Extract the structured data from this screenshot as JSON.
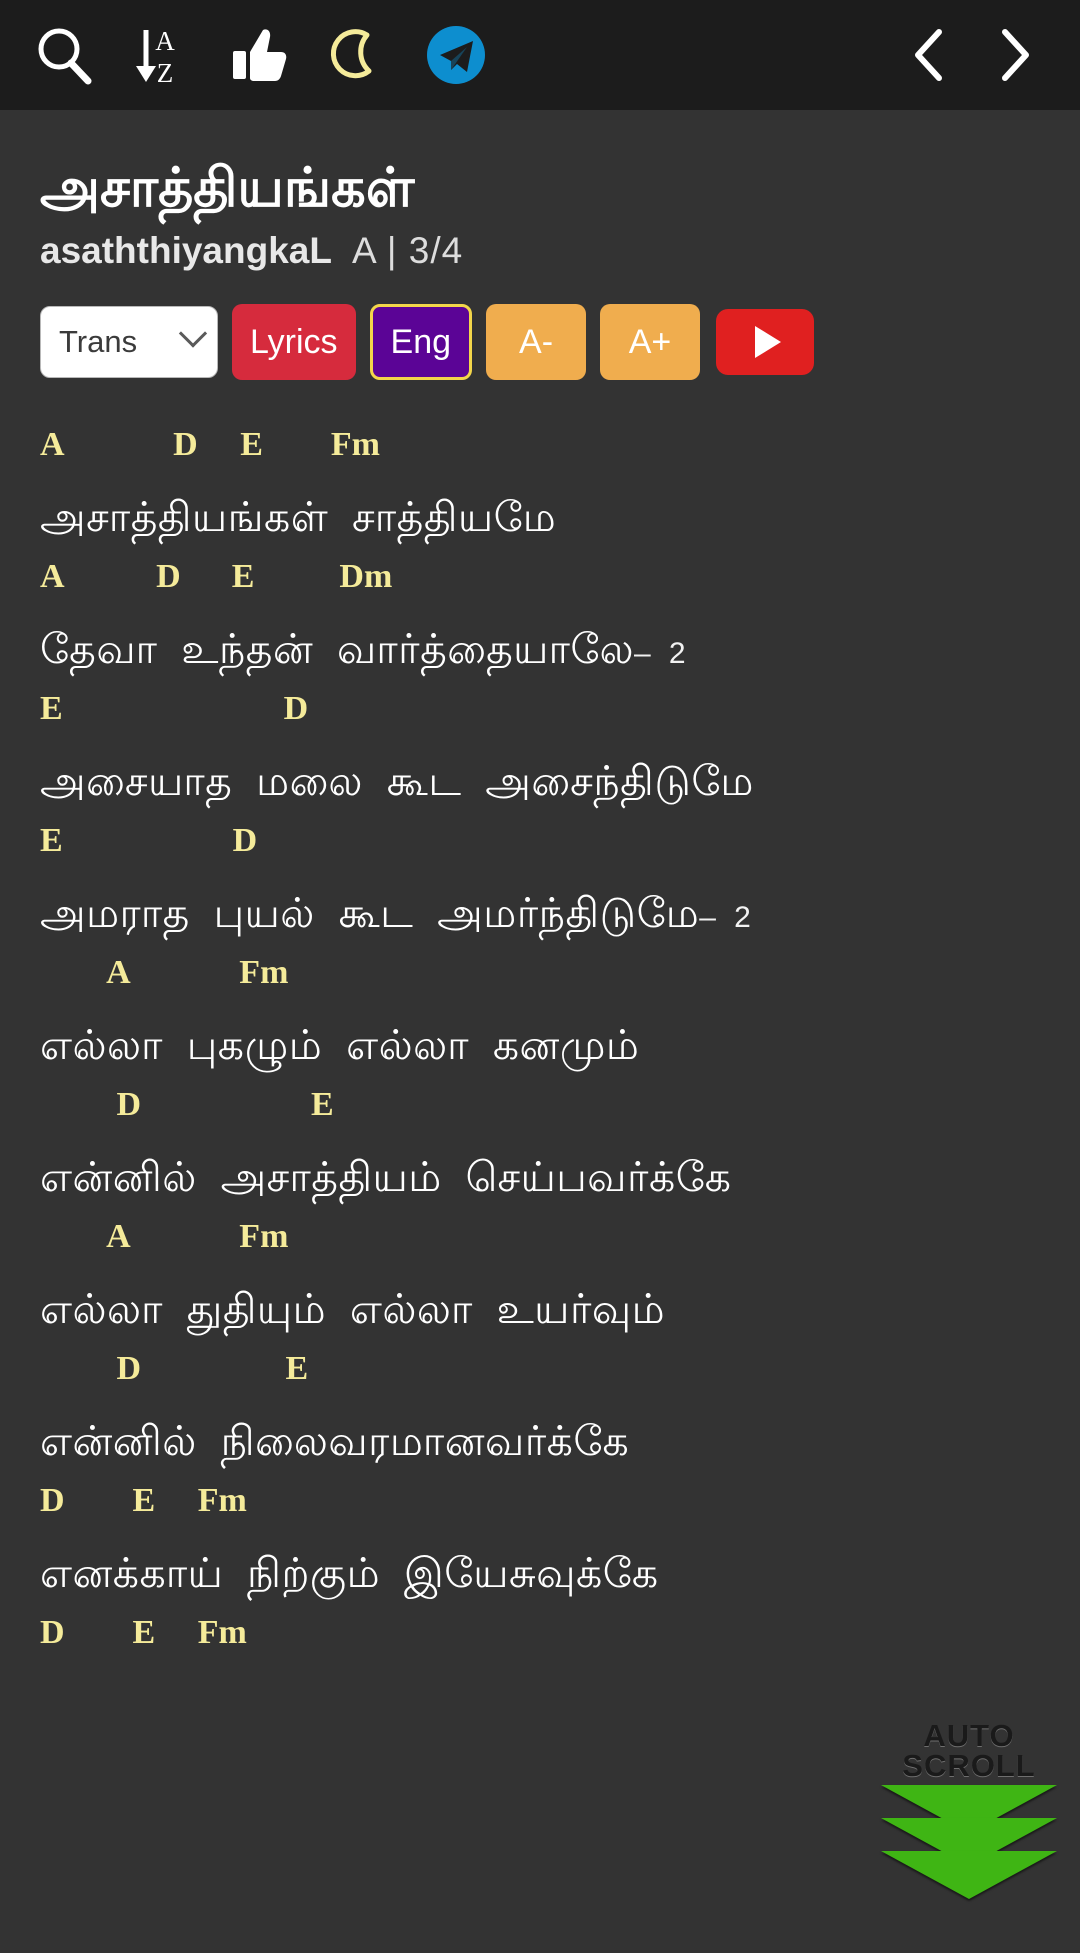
{
  "toolbar": {
    "left_icons": [
      {
        "name": "search-icon",
        "label": "Search"
      },
      {
        "name": "sort-alpha-icon",
        "label": "Sort A-Z"
      },
      {
        "name": "thumbs-up-icon",
        "label": "Like"
      },
      {
        "name": "moon-icon",
        "label": "Night mode"
      },
      {
        "name": "telegram-icon",
        "label": "Telegram"
      }
    ],
    "right_icons": [
      {
        "name": "chevron-left-icon",
        "label": "Previous"
      },
      {
        "name": "chevron-right-icon",
        "label": "Next"
      }
    ]
  },
  "song": {
    "title": "அசாத்தியங்கள்",
    "transliteration": "asaththiyangkaL",
    "key_and_time": "A | 3/4"
  },
  "controls": {
    "trans_label": "Trans",
    "lyrics_label": "Lyrics",
    "eng_label": "Eng",
    "font_decrease_label": "A-",
    "font_increase_label": "A+",
    "youtube_label": "Play on YouTube"
  },
  "colors": {
    "background": "#333333",
    "toolbar_bg": "#1c1c1c",
    "chord": "#f5eb9a",
    "lyric": "#ffffff",
    "lyrics_button": "#d62b3d",
    "eng_button": "#5b0496",
    "eng_border": "#f3d64a",
    "font_button": "#f0ad4e",
    "youtube_button": "#e02020",
    "telegram": "#0d8ecf",
    "moon": "#f5eb9a",
    "autoscroll_arrow": "#3fb514"
  },
  "autoscroll": {
    "line1": "AUTO",
    "line2": "SCROLL"
  },
  "sheet": [
    {
      "chords": "A             D     E        Fm",
      "lyric": "அசாத்தியங்கள்  சாத்தியமே",
      "repeat": ""
    },
    {
      "chords": "A           D      E          Dm",
      "lyric": "தேவா  உந்தன்  வார்த்தையாலே",
      "repeat": "–  2"
    },
    {
      "chords": "E                          D",
      "lyric": "அசையாத  மலை  கூட  அசைந்திடுமே",
      "repeat": ""
    },
    {
      "chords": "E                    D",
      "lyric": "அமராத  புயல்  கூட  அமர்ந்திடுமே",
      "repeat": "–  2"
    },
    {
      "chords": "        A             Fm",
      "lyric": "எல்லா  புகழும்  எல்லா  கனமும்",
      "repeat": ""
    },
    {
      "chords": "         D                    E",
      "lyric": "என்னில்  அசாத்தியம்  செய்பவர்க்கே",
      "repeat": ""
    },
    {
      "chords": "        A             Fm",
      "lyric": "எல்லா  துதியும்  எல்லா  உயர்வும்",
      "repeat": ""
    },
    {
      "chords": "         D                 E",
      "lyric": "என்னில்  நிலைவரமானவர்க்கே",
      "repeat": ""
    },
    {
      "chords": "D        E     Fm",
      "lyric": "எனக்காய்  நிற்கும்  இயேசுவுக்கே",
      "repeat": ""
    },
    {
      "chords": "D        E     Fm",
      "lyric": "",
      "repeat": ""
    }
  ]
}
